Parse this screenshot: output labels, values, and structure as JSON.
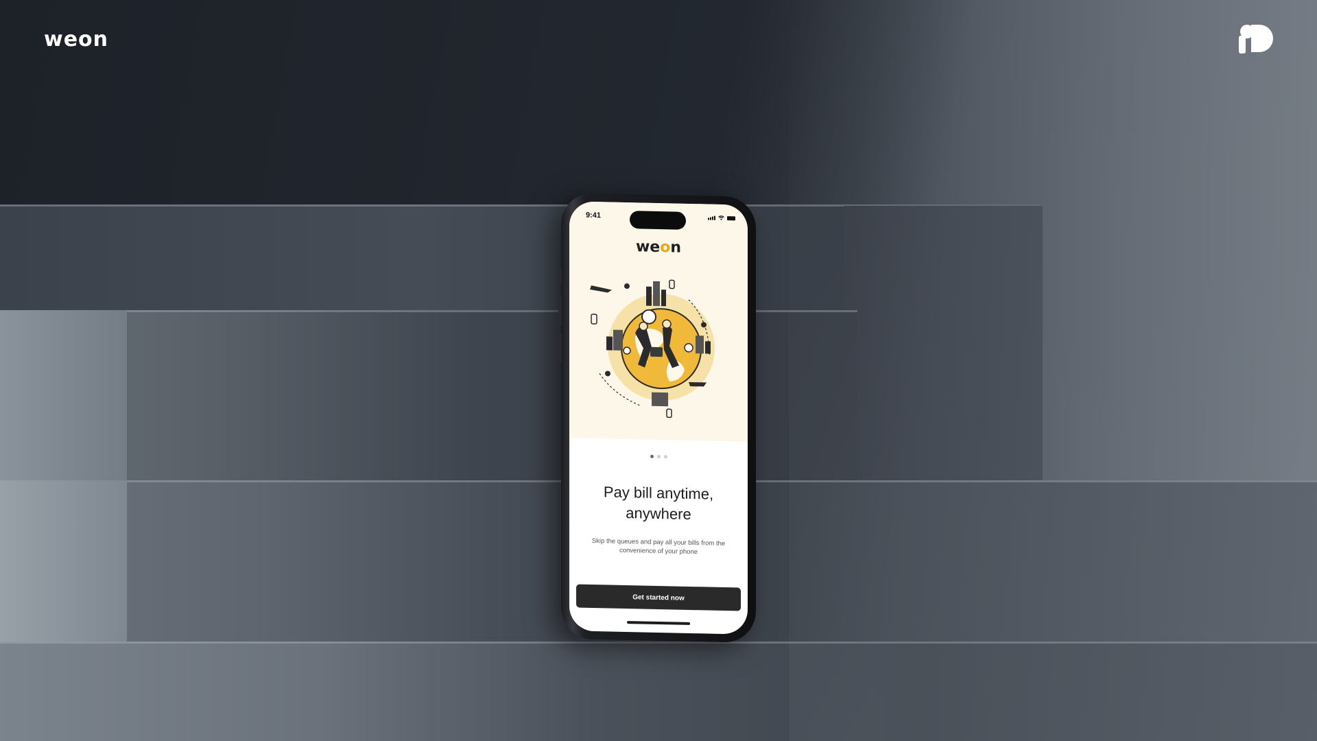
{
  "brand": {
    "logo_text": "weon",
    "corner_mark_icon": "studio-logo-icon"
  },
  "phone": {
    "status_bar": {
      "time": "9:41",
      "icons": [
        "cellular-signal-icon",
        "wifi-icon",
        "battery-icon"
      ]
    },
    "app_logo": {
      "prefix": "we",
      "accent": "o",
      "suffix": "n",
      "accent_color": "#e8a919"
    },
    "illustration_icon": "global-payments-illustration",
    "pagination": {
      "total": 3,
      "active": 1
    },
    "headline": "Pay bill anytime, anywhere",
    "subtext": "Skip the queues and pay all your bills from the convenience of your phone",
    "cta_label": "Get started now"
  },
  "colors": {
    "accent_yellow": "#e8a919",
    "screen_cream": "#fdf7ea",
    "button_dark": "#2a2a2a"
  }
}
